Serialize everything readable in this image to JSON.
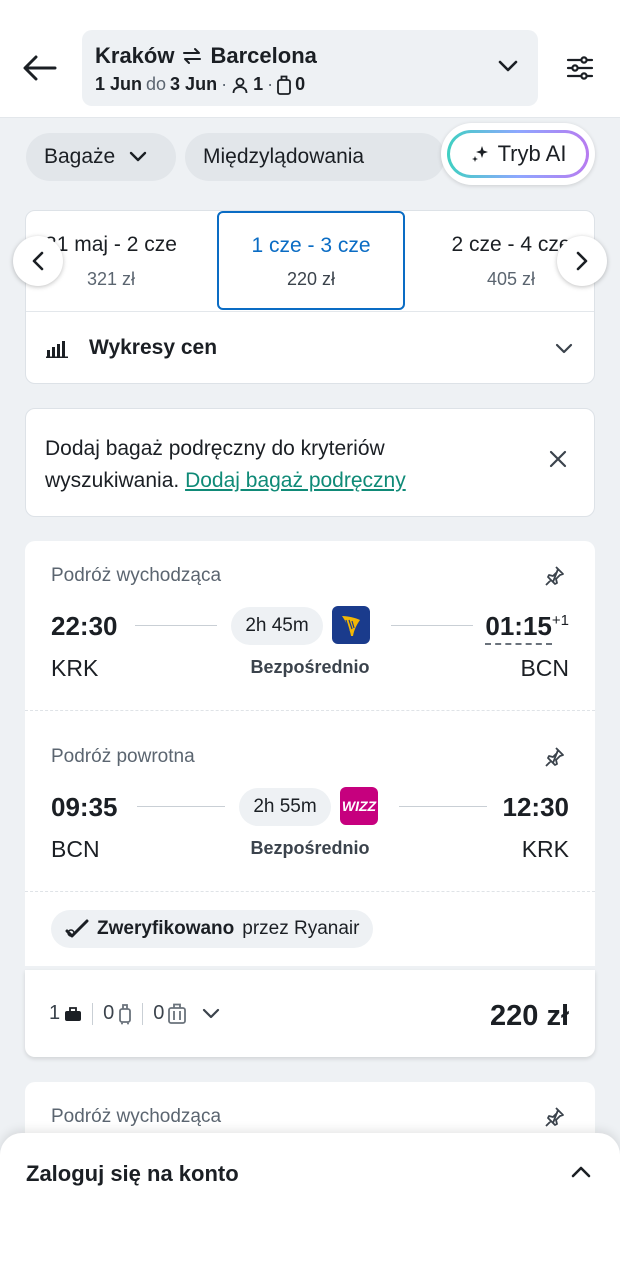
{
  "header": {
    "origin": "Kraków",
    "destination": "Barcelona",
    "date_from": "1 Jun",
    "date_sep": "do",
    "date_to": "3 Jun",
    "dot": "·",
    "passengers": "1",
    "bags": "0"
  },
  "filters": {
    "bags_label": "Bagaże",
    "stops_label": "Międzylądowania",
    "ai_label": "Tryb AI"
  },
  "dates": [
    {
      "range": "31 maj - 2 cze",
      "price": "321 zł"
    },
    {
      "range": "1 cze - 3 cze",
      "price": "220 zł"
    },
    {
      "range": "2 cze - 4 cze",
      "price": "405 zł"
    }
  ],
  "price_charts": {
    "label": "Wykresy cen"
  },
  "notice": {
    "text": "Dodaj bagaż podręczny do kryteriów wyszukiwania.",
    "link": "Dodaj bagaż podręczny"
  },
  "itinerary": {
    "outbound": {
      "title": "Podróż wychodząca",
      "dep_time": "22:30",
      "arr_time": "01:15",
      "plus_day": "+1",
      "dep_code": "KRK",
      "arr_code": "BCN",
      "duration": "2h 45m",
      "stops": "Bezpośrednio"
    },
    "return": {
      "title": "Podróż powrotna",
      "dep_time": "09:35",
      "arr_time": "12:30",
      "dep_code": "BCN",
      "arr_code": "KRK",
      "duration": "2h 55m",
      "stops": "Bezpośrednio",
      "airline_logo_text": "WIZZ"
    },
    "verified_bold": "Zweryfikowano",
    "verified_rest": "przez Ryanair"
  },
  "price_row": {
    "personal_item": "1",
    "cabin_bag": "0",
    "checked_bag": "0",
    "total": "220 zł"
  },
  "next_itinerary": {
    "title": "Podróż wychodząca"
  },
  "login": {
    "title": "Zaloguj się na konto"
  },
  "colors": {
    "accent": "#0a6cc4",
    "link": "#0f8a77",
    "ryanair": "#1a3b8c",
    "wizzair": "#c6007e"
  }
}
